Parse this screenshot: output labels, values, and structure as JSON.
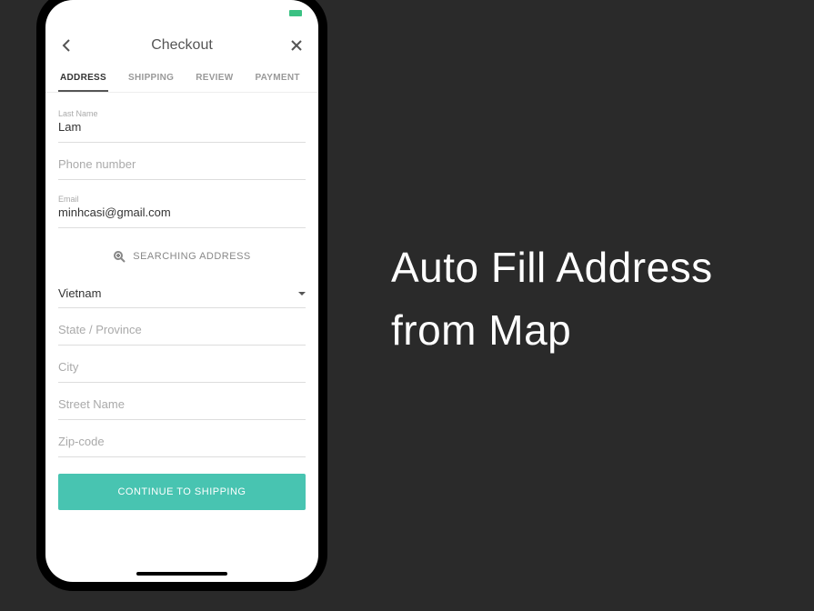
{
  "caption": {
    "line1": "Auto Fill Address",
    "line2": "from Map"
  },
  "header": {
    "title": "Checkout"
  },
  "tabs": {
    "address": "ADDRESS",
    "shipping": "SHIPPING",
    "review": "REVIEW",
    "payment": "PAYMENT"
  },
  "form": {
    "lastName": {
      "label": "Last Name",
      "value": "Lam"
    },
    "phone": {
      "placeholder": "Phone number"
    },
    "email": {
      "label": "Email",
      "value": "minhcasi@gmail.com"
    },
    "searchAddress": "SEARCHING ADDRESS",
    "country": {
      "value": "Vietnam"
    },
    "state": {
      "placeholder": "State / Province"
    },
    "city": {
      "placeholder": "City"
    },
    "street": {
      "placeholder": "Street Name"
    },
    "zip": {
      "placeholder": "Zip-code"
    },
    "cta": "CONTINUE TO SHIPPING"
  }
}
